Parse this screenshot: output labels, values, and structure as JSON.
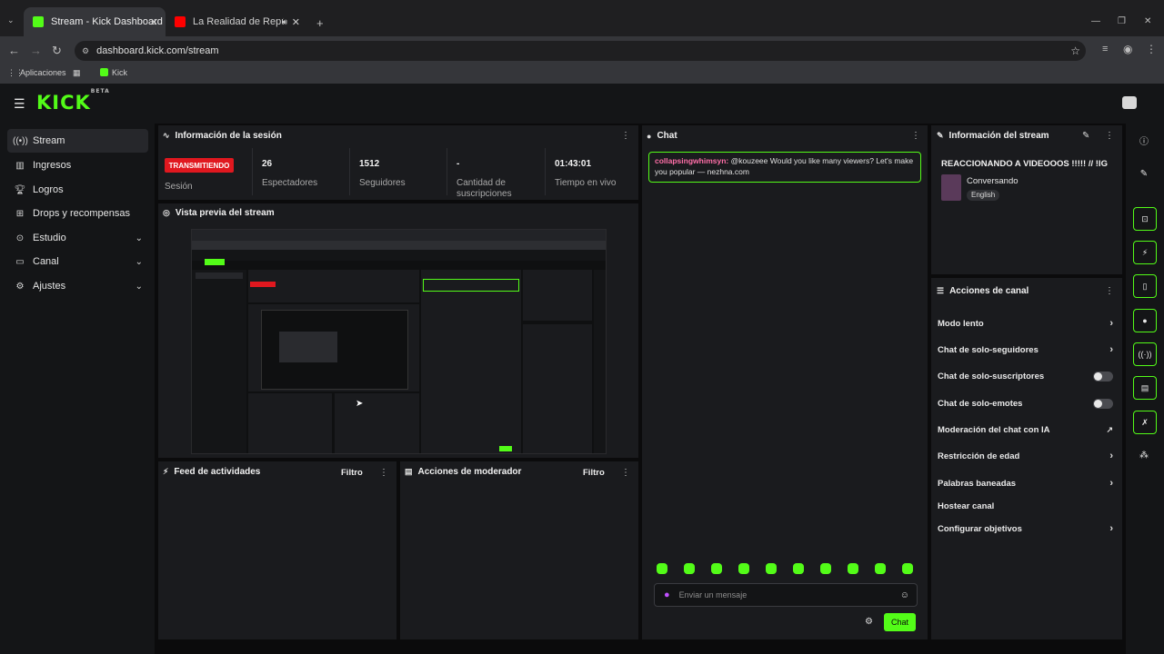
{
  "browser": {
    "tabs": [
      {
        "title": "Stream - Kick Dashboard",
        "close": "✕"
      },
      {
        "title": "La Realidad de República D",
        "close": "✕"
      }
    ],
    "new_tab": "+",
    "url": "dashboard.kick.com/stream",
    "bookmarks": [
      {
        "label": "Aplicaciones"
      },
      {
        "label": "Kick"
      }
    ],
    "window_controls": {
      "minimize": "—",
      "maximize": "❐",
      "close": "✕"
    }
  },
  "header": {
    "logo": "KICK",
    "logo_sup": "BETA"
  },
  "sidebar": {
    "items": [
      {
        "label": "Stream",
        "icon": "stream-icon",
        "active": true
      },
      {
        "label": "Ingresos",
        "icon": "revenue-icon"
      },
      {
        "label": "Logros",
        "icon": "trophy-icon"
      },
      {
        "label": "Drops y recompensas",
        "icon": "gift-icon"
      },
      {
        "label": "Estudio",
        "icon": "studio-icon",
        "expandable": true
      },
      {
        "label": "Canal",
        "icon": "channel-icon",
        "expandable": true
      },
      {
        "label": "Ajustes",
        "icon": "gear-icon",
        "expandable": true
      }
    ]
  },
  "session": {
    "title": "Información de la sesión",
    "status_badge": "TRANSMITIENDO",
    "status_label": "Sesión",
    "stats": [
      {
        "value": "26",
        "label": "Espectadores"
      },
      {
        "value": "1512",
        "label": "Seguidores"
      },
      {
        "value": "-",
        "label": "Cantidad de suscripciones"
      },
      {
        "value": "01:43:01",
        "label": "Tiempo en vivo"
      }
    ]
  },
  "preview": {
    "title": "Vista previa del stream"
  },
  "activity": {
    "title": "Feed de actividades",
    "filter": "Filtro"
  },
  "moderator": {
    "title": "Acciones de moderador",
    "filter": "Filtro"
  },
  "chat": {
    "title": "Chat",
    "messages": [
      {
        "user": "collapsingwhimsyn:",
        "text": "@kouzeee Would you like many viewers? Let's make you popular — nezhna.com"
      }
    ],
    "input_placeholder": "Enviar un mensaje",
    "send_label": "Chat"
  },
  "stream_info": {
    "title": "Información del stream",
    "stream_title": "REACCIONANDO A VIDEOOOS !!!!! // !IG",
    "category": "Conversando",
    "language": "English"
  },
  "channel_actions": {
    "title": "Acciones de canal",
    "items": [
      {
        "label": "Modo lento",
        "control": "chevron"
      },
      {
        "label": "Chat de solo-seguidores",
        "control": "chevron"
      },
      {
        "label": "Chat de solo-suscriptores",
        "control": "toggle",
        "on": false
      },
      {
        "label": "Chat de solo-emotes",
        "control": "toggle",
        "on": false
      },
      {
        "label": "Moderación del chat con IA",
        "control": "external"
      },
      {
        "label": "Restricción de edad",
        "control": "chevron"
      },
      {
        "label": "Palabras baneadas",
        "control": "chevron"
      },
      {
        "label": "Hostear canal",
        "control": "none"
      },
      {
        "label": "Configurar objetivos",
        "control": "chevron"
      }
    ]
  },
  "colors": {
    "accent": "#53fc18",
    "live": "#e0181f",
    "chat_user": "#ff6fa8"
  }
}
